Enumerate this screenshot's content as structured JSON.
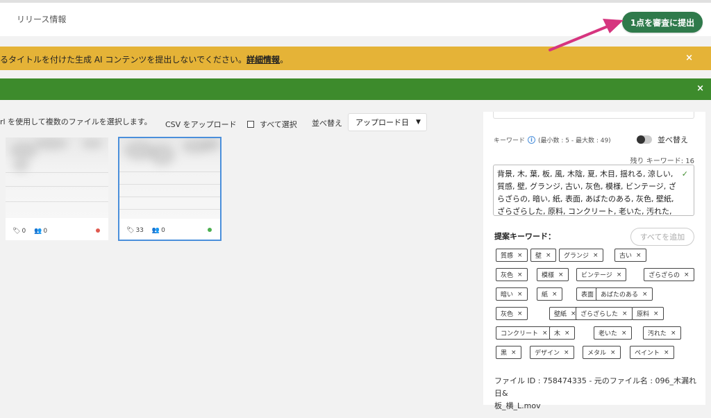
{
  "header": {
    "release_info": "リリース情報",
    "submit_button": "1点を審査に提出"
  },
  "warning_banner": {
    "text": "るタイトルを付けた生成 AI コンテンツを提出しないでください。",
    "link": "詳細情報",
    "suffix": "。",
    "close": "×"
  },
  "success_banner": {
    "close": "×"
  },
  "toolbar": {
    "hint": "rl を使用して複数のファイルを選択します。",
    "csv_upload": "CSV をアップロード",
    "select_all": "すべて選択",
    "sort_label": "並べ替え",
    "sort_value": "アップロード日"
  },
  "files": [
    {
      "keywords": "0",
      "people": "0",
      "status_color": "#e05a50"
    },
    {
      "keywords": "33",
      "people": "0",
      "status_color": "#4caf50"
    }
  ],
  "panel": {
    "keyword_label": "キーワード",
    "keyword_range": "(最小数 : 5 - 最大数 : 49)",
    "sort_toggle_label": "並べ替え",
    "remaining": "残り キーワード: 16",
    "keywords_text": "背景, 木, 葉, 板, 風, 木陰, 夏, 木目, 揺れる, 涼しい, 質感, 壁, グランジ, 古い, 灰色, 模様, ビンテージ, ざらざらの, 暗い, 紙, 表面, あばたのある, 灰色, 壁紙, ざらざらした, 原料, コンクリート, 老いた, 汚れた, 黒,",
    "suggest_title": "提案キーワード：",
    "add_all": "すべてを追加",
    "suggested": [
      "質感",
      "壁",
      "グランジ",
      "古い",
      "灰色",
      "模様",
      "ビンテージ",
      "ざらざらの",
      "暗い",
      "紙",
      "表面",
      "あばたのある",
      "灰色",
      "壁紙",
      "ざらざらした",
      "原料",
      "コンクリート",
      "木",
      "老いた",
      "汚れた",
      "黒",
      "デザイン",
      "メタル",
      "ペイント"
    ],
    "file_info_line1": "ファイル ID : 758474335 - 元のファイル名 : 096_木漏れ日&",
    "file_info_line2": "板_横_L.mov"
  },
  "colors": {
    "submit": "#2f7a4b",
    "warning": "#e5b337",
    "success": "#3d8b2c",
    "selection": "#4a8fdb",
    "arrow": "#d6357f"
  }
}
